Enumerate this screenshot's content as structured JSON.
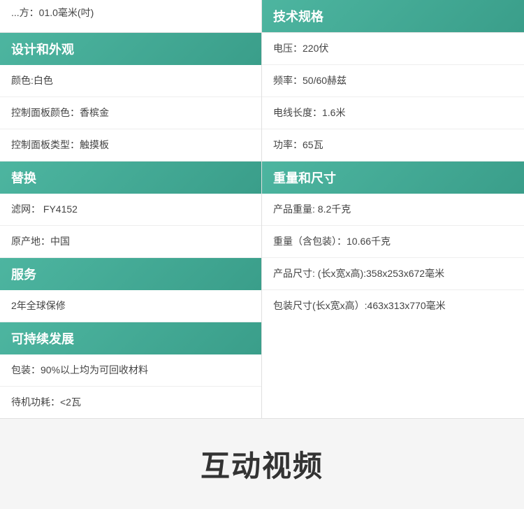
{
  "top_partial": {
    "left_text": "...方：01.0毫米(吋)",
    "right_header": "技术规格"
  },
  "left_column": {
    "section1": {
      "header": "设计和外观",
      "rows": [
        "颜色:白色",
        "控制面板颜色：香槟金",
        "控制面板类型：触摸板"
      ]
    },
    "section2": {
      "header": "替换",
      "rows": [
        "滤网：  FY4152",
        "原产地：中国"
      ]
    },
    "section3": {
      "header": "服务",
      "rows": [
        "2年全球保修"
      ]
    },
    "section4": {
      "header": "可持续发展",
      "rows": [
        "包装：90%以上均为可回收材料",
        "待机功耗：<2瓦"
      ]
    }
  },
  "right_column": {
    "section1": {
      "rows": [
        "电压：220伏",
        "频率：50/60赫兹",
        "电线长度：1.6米",
        "功率：65瓦"
      ]
    },
    "section2": {
      "header": "重量和尺寸",
      "rows": [
        "产品重量: 8.2千克",
        "重量（含包装）：10.66千克",
        "产品尺寸: (长x宽x高):358x253x672毫米",
        "包装尺寸(长x宽x高）:463x313x770毫米"
      ]
    }
  },
  "bottom_banner": {
    "title": "互动视频"
  },
  "colors": {
    "header_bg_start": "#4db5a0",
    "header_bg_end": "#3a9e8a"
  }
}
